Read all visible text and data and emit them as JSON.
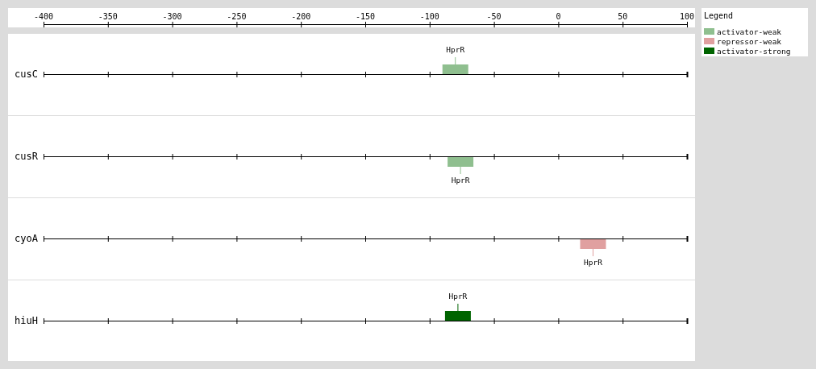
{
  "axis": {
    "ticks": [
      "-400",
      "-350",
      "-300",
      "-250",
      "-200",
      "-150",
      "-100",
      "-50",
      "0",
      "50",
      "100"
    ]
  },
  "tracks": [
    {
      "name": "cusC",
      "sites": [
        {
          "label": "HprR",
          "level": 0.64,
          "kind": "above",
          "color": "#8fbf8f"
        }
      ]
    },
    {
      "name": "cusR",
      "sites": [
        {
          "label": "HprR",
          "level": 0.648,
          "kind": "below",
          "color": "#8fbf8f"
        }
      ]
    },
    {
      "name": "cyoA",
      "sites": [
        {
          "label": "HprR",
          "level": 0.854,
          "kind": "below",
          "color": "#e0a0a0"
        }
      ]
    },
    {
      "name": "hiuH",
      "sites": [
        {
          "label": "HprR",
          "level": 0.644,
          "kind": "above",
          "color": "#006400"
        }
      ]
    }
  ],
  "legend": {
    "title": "Legend",
    "items": [
      {
        "label": "activator-weak",
        "color": "#8fbf8f"
      },
      {
        "label": "repressor-weak",
        "color": "#e0a0a0"
      },
      {
        "label": "activator-strong",
        "color": "#006400"
      }
    ]
  }
}
